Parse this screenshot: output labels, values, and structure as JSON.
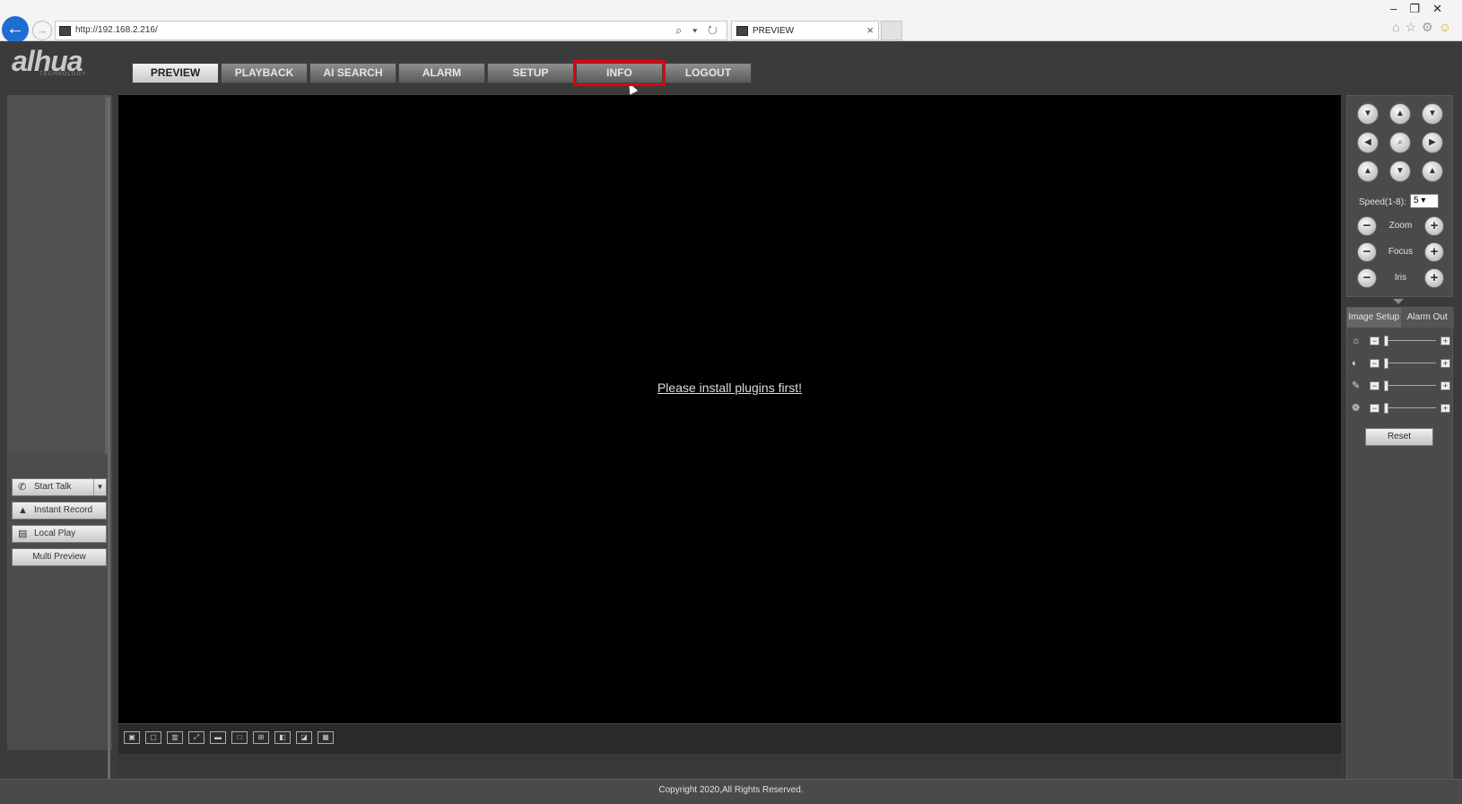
{
  "browser": {
    "url": "http://192.168.2.216/",
    "tab_title": "PREVIEW",
    "tab_close": "×",
    "address_controls": "⌕ ▾ ↻",
    "back": "←",
    "forward": "→",
    "window_controls": "–❐✕"
  },
  "app": {
    "logo": "alhua",
    "logo_sub": "TECHNOLOGY",
    "nav": [
      "PREVIEW",
      "PLAYBACK",
      "AI SEARCH",
      "ALARM",
      "SETUP",
      "INFO",
      "LOGOUT"
    ],
    "active_tab": "PREVIEW",
    "highlighted_tab": "INFO"
  },
  "left_panel": {
    "start_talk": "Start Talk",
    "instant_record": "Instant Record",
    "local_play": "Local Play",
    "multi_preview": "Multi Preview"
  },
  "video": {
    "message": "Please install plugins first!"
  },
  "ptz": {
    "speed_label": "Speed(1-8):",
    "speed_value": "5",
    "zoom_label": "Zoom",
    "focus_label": "Focus",
    "iris_label": "Iris"
  },
  "image_panel": {
    "tabs": [
      "Image Setup",
      "Alarm Out"
    ],
    "active_tab": "Image Setup",
    "reset_label": "Reset",
    "slider_levels": [
      0,
      0,
      0,
      0
    ]
  },
  "footer": {
    "copyright": "Copyright 2020,All Rights Reserved."
  },
  "colors": {
    "highlight": "#e00010",
    "back_button": "#1e6fd1"
  }
}
